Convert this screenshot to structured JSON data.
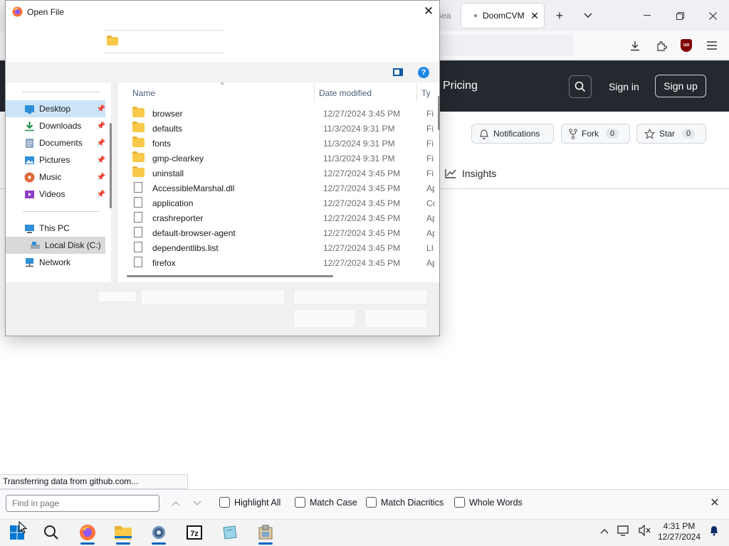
{
  "browser": {
    "partial_tab_label": "Sea",
    "active_tab_label": "DoomCVM",
    "new_tab_icon": "plus-icon",
    "tab_list_icon": "chevron-down-icon",
    "window_controls": [
      "minimize-icon",
      "restore-icon",
      "close-icon"
    ],
    "toolbar_icons": [
      "download-icon",
      "extensions-icon",
      "ublock-icon",
      "menu-icon"
    ],
    "ublock_badge": "uo"
  },
  "github": {
    "pricing": "Pricing",
    "sign_in": "Sign in",
    "sign_up": "Sign up",
    "notifications": "Notifications",
    "fork": "Fork",
    "fork_count": "0",
    "star": "Star",
    "star_count": "0",
    "insights": "Insights"
  },
  "dialog": {
    "title": "Open File",
    "nav": {
      "items": [
        {
          "label": "Desktop",
          "icon": "desktop-icon",
          "pinned": true
        },
        {
          "label": "Downloads",
          "icon": "download-icon",
          "pinned": true
        },
        {
          "label": "Documents",
          "icon": "documents-icon",
          "pinned": true
        },
        {
          "label": "Pictures",
          "icon": "pictures-icon",
          "pinned": true
        },
        {
          "label": "Music",
          "icon": "music-icon",
          "pinned": true
        },
        {
          "label": "Videos",
          "icon": "videos-icon",
          "pinned": true
        }
      ],
      "this_pc": "This PC",
      "local_disk": "Local Disk (C:)",
      "network": "Network"
    },
    "columns": {
      "name": "Name",
      "date": "Date modified",
      "type": "Ty"
    },
    "files": [
      {
        "name": "browser",
        "date": "12/27/2024 3:45 PM",
        "type": "Fi",
        "kind": "folder"
      },
      {
        "name": "defaults",
        "date": "11/3/2024 9:31 PM",
        "type": "Fi",
        "kind": "folder"
      },
      {
        "name": "fonts",
        "date": "11/3/2024 9:31 PM",
        "type": "Fi",
        "kind": "folder"
      },
      {
        "name": "gmp-clearkey",
        "date": "11/3/2024 9:31 PM",
        "type": "Fi",
        "kind": "folder"
      },
      {
        "name": "uninstall",
        "date": "12/27/2024 3:45 PM",
        "type": "Fi",
        "kind": "folder"
      },
      {
        "name": "AccessibleMarshal.dll",
        "date": "12/27/2024 3:45 PM",
        "type": "Ap",
        "kind": "file"
      },
      {
        "name": "application",
        "date": "12/27/2024 3:45 PM",
        "type": "Co",
        "kind": "file"
      },
      {
        "name": "crashreporter",
        "date": "12/27/2024 3:45 PM",
        "type": "Ap",
        "kind": "file"
      },
      {
        "name": "default-browser-agent",
        "date": "12/27/2024 3:45 PM",
        "type": "Ap",
        "kind": "file"
      },
      {
        "name": "dependentlibs.list",
        "date": "12/27/2024 3:45 PM",
        "type": "LI",
        "kind": "file"
      },
      {
        "name": "firefox",
        "date": "12/27/2024 3:45 PM",
        "type": "Ap",
        "kind": "file"
      }
    ]
  },
  "status_text": "Transferring data from github.com...",
  "findbar": {
    "placeholder": "Find in page",
    "options": [
      "Highlight All",
      "Match Case",
      "Match Diacritics",
      "Whole Words"
    ]
  },
  "taskbar": {
    "apps": [
      "start-icon",
      "search-icon",
      "firefox-icon",
      "file-explorer-icon",
      "settings-icon",
      "7zip-icon",
      "app-icon",
      "package-icon"
    ],
    "clock_time": "4:31 PM",
    "clock_date": "12/27/2024"
  },
  "colors": {
    "github_header": "#24292f",
    "selection": "#cce4f7",
    "folder": "#f8c94a",
    "taskbar_accent": "#0067c0"
  }
}
